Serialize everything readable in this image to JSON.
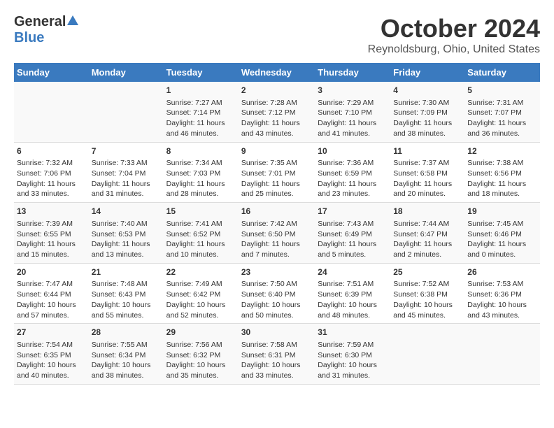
{
  "header": {
    "logo_general": "General",
    "logo_blue": "Blue",
    "title": "October 2024",
    "location": "Reynoldsburg, Ohio, United States"
  },
  "weekdays": [
    "Sunday",
    "Monday",
    "Tuesday",
    "Wednesday",
    "Thursday",
    "Friday",
    "Saturday"
  ],
  "weeks": [
    [
      {
        "day": "",
        "info": ""
      },
      {
        "day": "",
        "info": ""
      },
      {
        "day": "1",
        "info": "Sunrise: 7:27 AM\nSunset: 7:14 PM\nDaylight: 11 hours and 46 minutes."
      },
      {
        "day": "2",
        "info": "Sunrise: 7:28 AM\nSunset: 7:12 PM\nDaylight: 11 hours and 43 minutes."
      },
      {
        "day": "3",
        "info": "Sunrise: 7:29 AM\nSunset: 7:10 PM\nDaylight: 11 hours and 41 minutes."
      },
      {
        "day": "4",
        "info": "Sunrise: 7:30 AM\nSunset: 7:09 PM\nDaylight: 11 hours and 38 minutes."
      },
      {
        "day": "5",
        "info": "Sunrise: 7:31 AM\nSunset: 7:07 PM\nDaylight: 11 hours and 36 minutes."
      }
    ],
    [
      {
        "day": "6",
        "info": "Sunrise: 7:32 AM\nSunset: 7:06 PM\nDaylight: 11 hours and 33 minutes."
      },
      {
        "day": "7",
        "info": "Sunrise: 7:33 AM\nSunset: 7:04 PM\nDaylight: 11 hours and 31 minutes."
      },
      {
        "day": "8",
        "info": "Sunrise: 7:34 AM\nSunset: 7:03 PM\nDaylight: 11 hours and 28 minutes."
      },
      {
        "day": "9",
        "info": "Sunrise: 7:35 AM\nSunset: 7:01 PM\nDaylight: 11 hours and 25 minutes."
      },
      {
        "day": "10",
        "info": "Sunrise: 7:36 AM\nSunset: 6:59 PM\nDaylight: 11 hours and 23 minutes."
      },
      {
        "day": "11",
        "info": "Sunrise: 7:37 AM\nSunset: 6:58 PM\nDaylight: 11 hours and 20 minutes."
      },
      {
        "day": "12",
        "info": "Sunrise: 7:38 AM\nSunset: 6:56 PM\nDaylight: 11 hours and 18 minutes."
      }
    ],
    [
      {
        "day": "13",
        "info": "Sunrise: 7:39 AM\nSunset: 6:55 PM\nDaylight: 11 hours and 15 minutes."
      },
      {
        "day": "14",
        "info": "Sunrise: 7:40 AM\nSunset: 6:53 PM\nDaylight: 11 hours and 13 minutes."
      },
      {
        "day": "15",
        "info": "Sunrise: 7:41 AM\nSunset: 6:52 PM\nDaylight: 11 hours and 10 minutes."
      },
      {
        "day": "16",
        "info": "Sunrise: 7:42 AM\nSunset: 6:50 PM\nDaylight: 11 hours and 7 minutes."
      },
      {
        "day": "17",
        "info": "Sunrise: 7:43 AM\nSunset: 6:49 PM\nDaylight: 11 hours and 5 minutes."
      },
      {
        "day": "18",
        "info": "Sunrise: 7:44 AM\nSunset: 6:47 PM\nDaylight: 11 hours and 2 minutes."
      },
      {
        "day": "19",
        "info": "Sunrise: 7:45 AM\nSunset: 6:46 PM\nDaylight: 11 hours and 0 minutes."
      }
    ],
    [
      {
        "day": "20",
        "info": "Sunrise: 7:47 AM\nSunset: 6:44 PM\nDaylight: 10 hours and 57 minutes."
      },
      {
        "day": "21",
        "info": "Sunrise: 7:48 AM\nSunset: 6:43 PM\nDaylight: 10 hours and 55 minutes."
      },
      {
        "day": "22",
        "info": "Sunrise: 7:49 AM\nSunset: 6:42 PM\nDaylight: 10 hours and 52 minutes."
      },
      {
        "day": "23",
        "info": "Sunrise: 7:50 AM\nSunset: 6:40 PM\nDaylight: 10 hours and 50 minutes."
      },
      {
        "day": "24",
        "info": "Sunrise: 7:51 AM\nSunset: 6:39 PM\nDaylight: 10 hours and 48 minutes."
      },
      {
        "day": "25",
        "info": "Sunrise: 7:52 AM\nSunset: 6:38 PM\nDaylight: 10 hours and 45 minutes."
      },
      {
        "day": "26",
        "info": "Sunrise: 7:53 AM\nSunset: 6:36 PM\nDaylight: 10 hours and 43 minutes."
      }
    ],
    [
      {
        "day": "27",
        "info": "Sunrise: 7:54 AM\nSunset: 6:35 PM\nDaylight: 10 hours and 40 minutes."
      },
      {
        "day": "28",
        "info": "Sunrise: 7:55 AM\nSunset: 6:34 PM\nDaylight: 10 hours and 38 minutes."
      },
      {
        "day": "29",
        "info": "Sunrise: 7:56 AM\nSunset: 6:32 PM\nDaylight: 10 hours and 35 minutes."
      },
      {
        "day": "30",
        "info": "Sunrise: 7:58 AM\nSunset: 6:31 PM\nDaylight: 10 hours and 33 minutes."
      },
      {
        "day": "31",
        "info": "Sunrise: 7:59 AM\nSunset: 6:30 PM\nDaylight: 10 hours and 31 minutes."
      },
      {
        "day": "",
        "info": ""
      },
      {
        "day": "",
        "info": ""
      }
    ]
  ]
}
